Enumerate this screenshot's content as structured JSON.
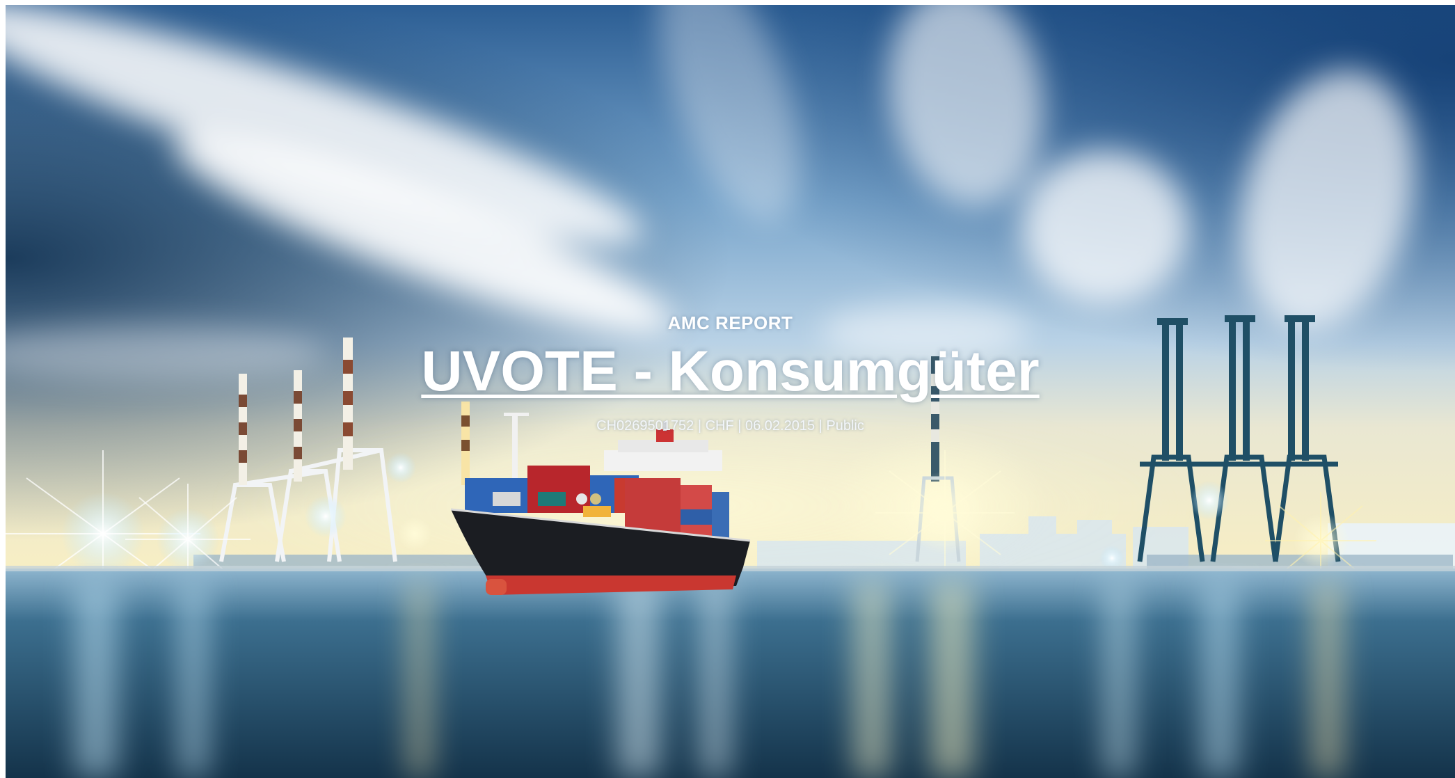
{
  "report": {
    "eyebrow": "AMC REPORT",
    "title": "UVOTE - Konsumgüter",
    "meta": "CH0269501752 | CHF | 06.02.2015 | Public"
  },
  "colors": {
    "sky_top": "#1f4f86",
    "sky_mid": "#6f9fc8",
    "horizon_glow": "#fff3c4",
    "water": "#163a55",
    "text": "#ffffff"
  },
  "background": {
    "subject": "container-ship-port-icon"
  }
}
